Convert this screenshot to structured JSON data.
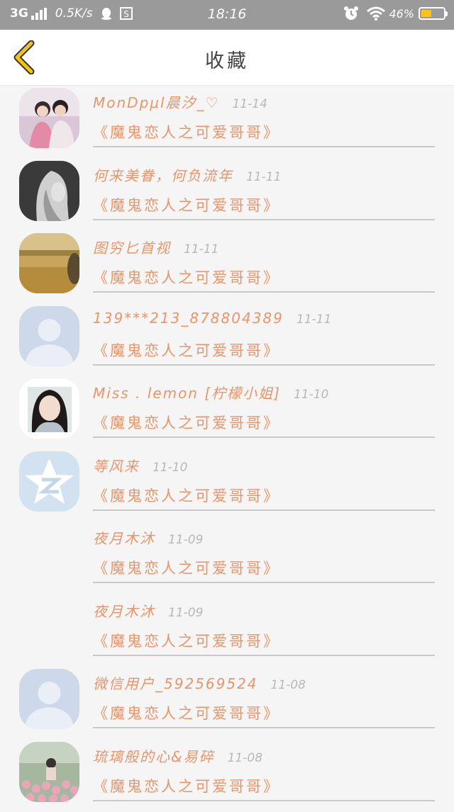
{
  "status_bar": {
    "network": "3G",
    "speed": "0.5K/s",
    "time": "18:16",
    "battery_text": "46%",
    "battery_level": 0.46,
    "accent": "#ffc21a"
  },
  "header": {
    "title": "收藏",
    "back_icon": "chevron-left-icon",
    "back_color": "#f0c419"
  },
  "colors": {
    "name": "#e8956a",
    "date": "#b8b8b8",
    "divider": "#c9c9c9"
  },
  "favorites": [
    {
      "name": "MonDpμl晨汐_♡",
      "date": "11-14",
      "book": "《魔鬼恋人之可爱哥哥》",
      "avatar": "couple-photo"
    },
    {
      "name": "何来美眷，何负流年",
      "date": "11-11",
      "book": "《魔鬼恋人之可爱哥哥》",
      "avatar": "blonde-girl-photo"
    },
    {
      "name": "图穷匕首视",
      "date": "11-11",
      "book": "《魔鬼恋人之可爱哥哥》",
      "avatar": "field-photo"
    },
    {
      "name": "139***213_878804389",
      "date": "11-11",
      "book": "《魔鬼恋人之可爱哥哥》",
      "avatar": "default-person"
    },
    {
      "name": "Miss . lemon [柠檬小姐]",
      "date": "11-10",
      "book": "《魔鬼恋人之可爱哥哥》",
      "avatar": "girl-portrait"
    },
    {
      "name": "等风来",
      "date": "11-10",
      "book": "《魔鬼恋人之可爱哥哥》",
      "avatar": "qzone-star"
    },
    {
      "name": "夜月木沐",
      "date": "11-09",
      "book": "《魔鬼恋人之可爱哥哥》",
      "avatar": "none"
    },
    {
      "name": "夜月木沐",
      "date": "11-09",
      "book": "《魔鬼恋人之可爱哥哥》",
      "avatar": "none"
    },
    {
      "name": "微信用户_592569524",
      "date": "11-08",
      "book": "《魔鬼恋人之可爱哥哥》",
      "avatar": "default-person"
    },
    {
      "name": "琉璃般的心&易碎",
      "date": "11-08",
      "book": "《魔鬼恋人之可爱哥哥》",
      "avatar": "flowers-photo"
    }
  ]
}
